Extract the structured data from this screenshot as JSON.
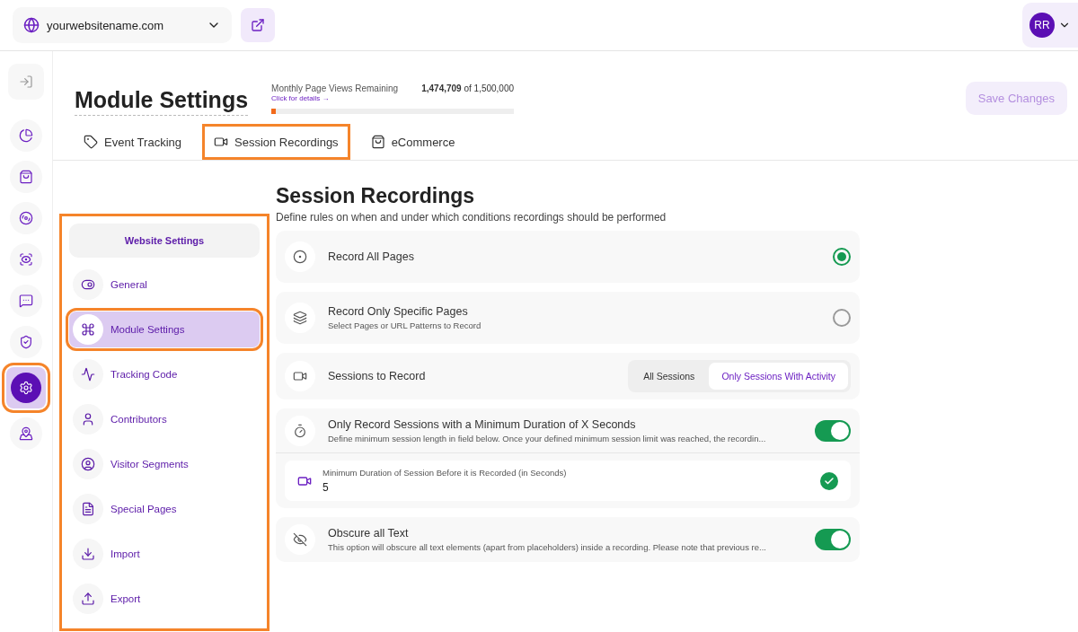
{
  "topbar": {
    "site": "yourwebsitename.com",
    "avatar": "RR"
  },
  "rail": [
    {
      "selected": false,
      "highlighted": false
    },
    {
      "selected": false,
      "highlighted": false
    },
    {
      "selected": false,
      "highlighted": false
    },
    {
      "selected": false,
      "highlighted": false
    },
    {
      "selected": false,
      "highlighted": false
    },
    {
      "selected": false,
      "highlighted": false
    },
    {
      "selected": false,
      "highlighted": false
    },
    {
      "selected": true,
      "highlighted": true
    },
    {
      "selected": false,
      "highlighted": false
    }
  ],
  "header": {
    "title": "Module Settings",
    "quota_label": "Monthly Page Views Remaining",
    "quota_link": "Click for details →",
    "quota_value": "**1,474,709** of 1,500,000",
    "level": 0.02,
    "save": "Save Changes"
  },
  "tabs": [
    {
      "label": "Event Tracking",
      "highlighted": false
    },
    {
      "label": "Session Recordings",
      "highlighted": true
    },
    {
      "label": "eCommerce",
      "highlighted": false
    }
  ],
  "settings_menu": {
    "title": "Website Settings",
    "highlighted": true,
    "items": [
      {
        "label": "General",
        "selected": false,
        "highlighted": false
      },
      {
        "label": "Module Settings",
        "selected": true,
        "highlighted": true
      },
      {
        "label": "Tracking Code",
        "selected": false,
        "highlighted": false
      },
      {
        "label": "Contributors",
        "selected": false,
        "highlighted": false
      },
      {
        "label": "Visitor Segments",
        "selected": false,
        "highlighted": false
      },
      {
        "label": "Special Pages",
        "selected": false,
        "highlighted": false
      },
      {
        "label": "Import",
        "selected": false,
        "highlighted": false
      },
      {
        "label": "Export",
        "selected": false,
        "highlighted": false
      }
    ]
  },
  "section": {
    "title": "Session Recordings",
    "subtitle": "Define rules on when and under which conditions recordings should be performed",
    "options": [
      {
        "kind": "radio",
        "title": "Record All Pages",
        "selected": true
      },
      {
        "kind": "radio",
        "title": "Record Only Specific Pages",
        "description": "Select Pages or URL Patterns to Record",
        "selected": false
      },
      {
        "kind": "segmented",
        "title": "Sessions to Record",
        "choices": [
          {
            "label": "All Sessions",
            "selected": false
          },
          {
            "label": "Only Sessions With Activity",
            "selected": true
          }
        ]
      },
      {
        "kind": "toggle",
        "title": "Only Record Sessions with a Minimum Duration of X Seconds",
        "description": "Define minimum session length in field below. Once your defined minimum session limit was reached, the recordin...",
        "on": true,
        "field": {
          "label": "Minimum Duration of Session Before it is Recorded (in Seconds)",
          "value": "5",
          "valid": true
        }
      },
      {
        "kind": "toggle",
        "title": "Obscure all Text",
        "description": "This option will obscure all text elements (apart from placeholders) inside a recording. Please note that previous re...",
        "on": true
      }
    ]
  }
}
